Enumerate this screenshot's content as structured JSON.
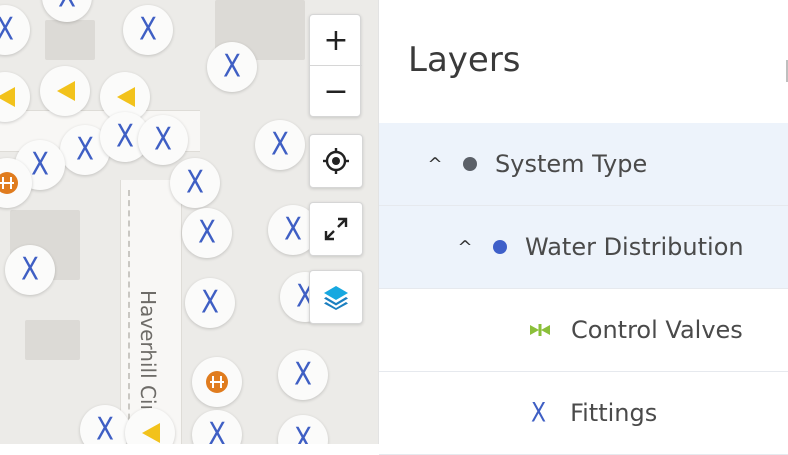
{
  "map": {
    "street_name": "Haverhill Cir",
    "controls": {
      "zoom_in": "+",
      "zoom_out": "−",
      "locate_icon": "crosshair-icon",
      "fullscreen_icon": "expand-icon",
      "layers_icon": "layers-icon"
    },
    "marker_types": {
      "fitting": "X",
      "hydrant": "yellow-triangle-icon",
      "valve": "orange-valve-icon"
    }
  },
  "panel": {
    "title": "Layers",
    "rows": [
      {
        "label": "System Type",
        "chevron": "^",
        "dot_color": "#5b6068"
      },
      {
        "label": "Water Distribution",
        "chevron": "^",
        "dot_color": "#3e5fc9"
      },
      {
        "label": "Control Valves",
        "icon": "control-valve-icon",
        "icon_color": "#8bbf3a"
      },
      {
        "label": "Fittings",
        "icon_text": "X",
        "icon_color": "#3f5fc4"
      }
    ]
  },
  "colors": {
    "selected_row_bg": "#edf3fb",
    "accent": "#3e5fc9",
    "fitting_blue": "#3f5fc4",
    "hydrant_yellow": "#f2c21b",
    "valve_orange": "#e07c1e"
  }
}
